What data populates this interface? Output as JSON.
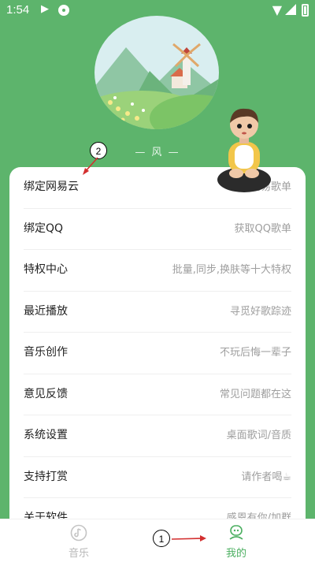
{
  "status": {
    "time": "1:54"
  },
  "header": {
    "subtitle": "— 风 —"
  },
  "menu": [
    {
      "label": "绑定网易云",
      "desc": "获取网易歌单"
    },
    {
      "label": "绑定QQ",
      "desc": "获取QQ歌单"
    },
    {
      "label": "特权中心",
      "desc": "批量,同步,换肤等十大特权"
    },
    {
      "label": "最近播放",
      "desc": "寻觅好歌踪迹"
    },
    {
      "label": "音乐创作",
      "desc": "不玩后悔一辈子"
    },
    {
      "label": "意见反馈",
      "desc": "常见问题都在这"
    },
    {
      "label": "系统设置",
      "desc": "桌面歌词/音质"
    },
    {
      "label": "支持打赏",
      "desc": "请作者喝☕"
    },
    {
      "label": "关于软件",
      "desc": "感恩有你/加群"
    }
  ],
  "tabbar": {
    "music": "音乐",
    "mine": "我的"
  },
  "annotations": {
    "one": "1",
    "two": "2"
  },
  "colors": {
    "header_bg": "#5db46c",
    "active_tab": "#4caf61"
  }
}
